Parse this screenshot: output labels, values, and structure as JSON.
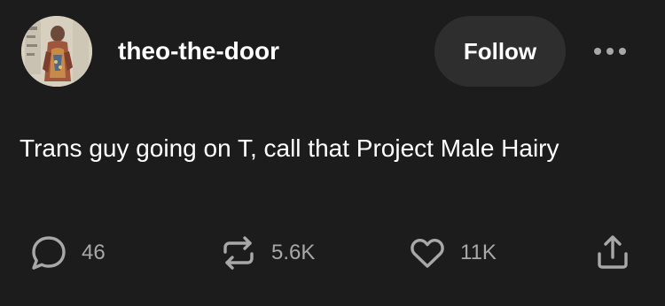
{
  "post": {
    "username": "theo-the-door",
    "follow_label": "Follow",
    "text": "Trans guy going on T, call that Project Male Hairy",
    "actions": {
      "reply_count": "46",
      "reblog_count": "5.6K",
      "like_count": "11K"
    }
  },
  "icons": {
    "more": "more-horizontal-icon",
    "reply": "speech-bubble-icon",
    "reblog": "repost-arrows-icon",
    "like": "heart-icon",
    "share": "share-upload-icon"
  },
  "colors": {
    "background": "#1c1c1c",
    "text": "#ffffff",
    "muted": "#a8a8a8",
    "button": "#2e2e2e"
  }
}
